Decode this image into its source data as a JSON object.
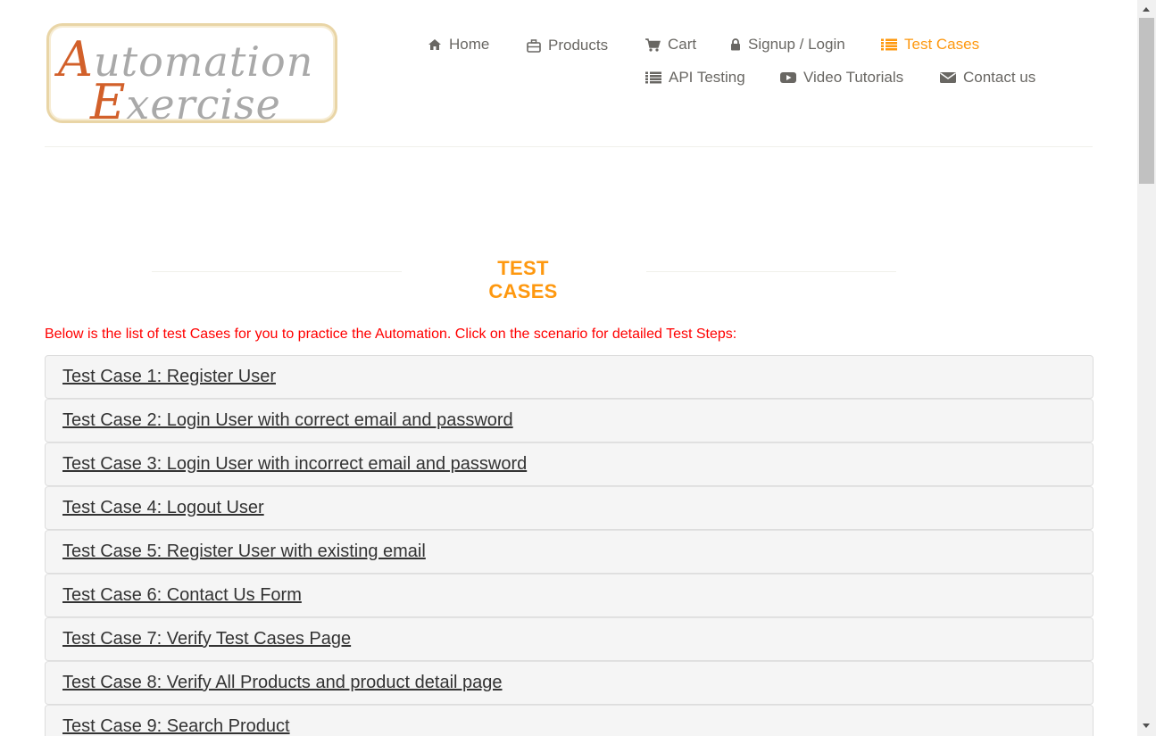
{
  "logo": {
    "line1_cap": "A",
    "line1_rest": "utomation",
    "line2_cap": "E",
    "line2_rest": "xercise"
  },
  "nav": {
    "home": "Home",
    "products": "Products",
    "cart": "Cart",
    "login": "Signup / Login",
    "test_cases": "Test Cases",
    "api_testing": "API Testing",
    "video_tutorials": "Video Tutorials",
    "contact": "Contact us",
    "active": "Test Cases",
    "active_color": "#fe980f"
  },
  "main": {
    "title": "TEST CASES",
    "intro": "Below is the list of test Cases for you to practice the Automation. Click on the scenario for detailed Test Steps:",
    "intro_color": "#ff0000",
    "cases": [
      "Test Case 1: Register User",
      "Test Case 2: Login User with correct email and password",
      "Test Case 3: Login User with incorrect email and password",
      "Test Case 4: Logout User",
      "Test Case 5: Register User with existing email",
      "Test Case 6: Contact Us Form",
      "Test Case 7: Verify Test Cases Page",
      "Test Case 8: Verify All Products and product detail page",
      "Test Case 9: Search Product"
    ]
  }
}
